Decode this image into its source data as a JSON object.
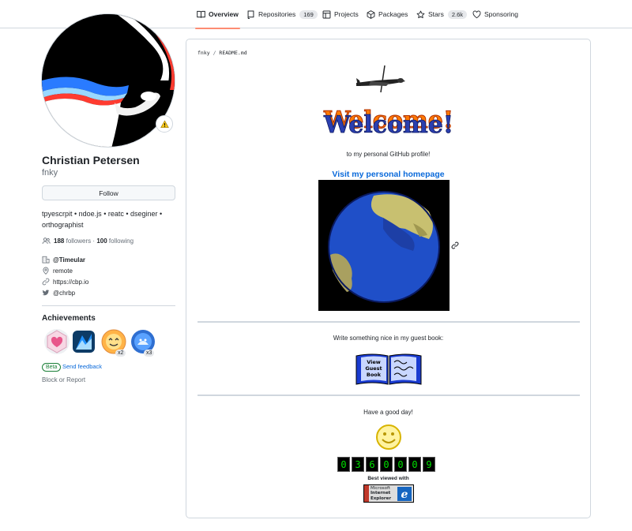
{
  "nav": {
    "tabs": [
      {
        "label": "Overview",
        "icon": "book-icon",
        "active": true
      },
      {
        "label": "Repositories",
        "icon": "repo-icon",
        "count": "169"
      },
      {
        "label": "Projects",
        "icon": "table-icon"
      },
      {
        "label": "Packages",
        "icon": "package-icon"
      },
      {
        "label": "Stars",
        "icon": "star-icon",
        "count": "2.6k"
      },
      {
        "label": "Sponsoring",
        "icon": "heart-icon"
      }
    ]
  },
  "profile": {
    "full_name": "Christian Petersen",
    "login": "fnky",
    "follow_label": "Follow",
    "bio": "tpyescrpit • ndoe.js • reatc • dseginer • orthographist",
    "followers_count": "188",
    "followers_label": "followers",
    "separator": "·",
    "following_count": "100",
    "following_label": "following",
    "company": "@Timeular",
    "location": "remote",
    "website": "https://cbp.io",
    "twitter": "@chrbp"
  },
  "achievements": {
    "title": "Achievements",
    "badges": [
      {
        "icon": "heart-badge-icon"
      },
      {
        "icon": "arctic-vault-badge-icon"
      },
      {
        "icon": "starstruck-badge-icon",
        "count": "x2"
      },
      {
        "icon": "pull-shark-badge-icon",
        "count": "x3"
      }
    ],
    "beta_label": "Beta",
    "feedback_label": "Send feedback"
  },
  "block_label": "Block or Report",
  "readme": {
    "path_owner": "fnky",
    "path_sep": "/",
    "path_file": "README.md",
    "welcome_text": "Welcome!",
    "intro": "to my personal GitHub profile!",
    "homepage_link": "Visit my personal homepage",
    "guestbook_text": "Write something nice in my guest book:",
    "guestbook_lines": [
      "View",
      "Guest",
      "Book"
    ],
    "goodbye": "Have a good day!",
    "counter_digits": [
      "0",
      "3",
      "6",
      "0",
      "0",
      "0",
      "9"
    ],
    "best_viewed": "Best viewed with",
    "ie_lines": [
      "Microsoft",
      "Internet",
      "Explorer"
    ]
  },
  "colors": {
    "accent_underline": "#fd8c73",
    "link": "#0969da",
    "border": "#d0d7de",
    "counter_digit": "#00e000"
  }
}
